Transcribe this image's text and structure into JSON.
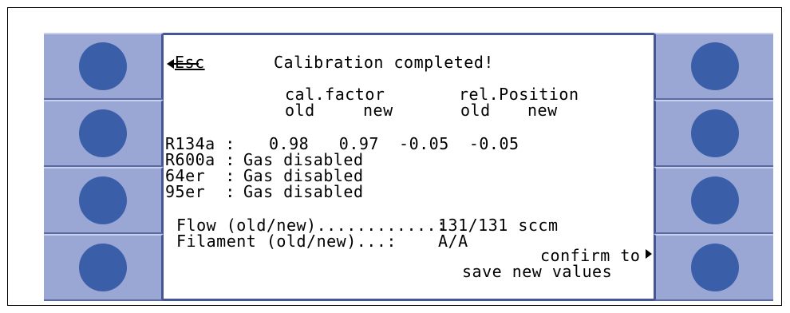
{
  "screen": {
    "esc_label": "Esc",
    "title": "Calibration completed!",
    "header_cal": "cal.factor",
    "header_rel": "rel.Position",
    "sub_old_1": "old",
    "sub_new_1": "new",
    "sub_old_2": "old",
    "sub_new_2": "new",
    "rows": [
      {
        "name": "R134a :",
        "value": "0.98   0.97  -0.05  -0.05"
      },
      {
        "name": "R600a :",
        "value": "Gas disabled"
      },
      {
        "name": "64er  :",
        "value": "Gas disabled"
      },
      {
        "name": "95er  :",
        "value": "Gas disabled"
      }
    ],
    "flow_label": "Flow (old/new)............:",
    "flow_value": "131/131 sccm",
    "filament_label": "Filament (old/new)...:",
    "filament_value": "A/A",
    "confirm_line1": "confirm to",
    "confirm_line2": "save new values"
  },
  "colors": {
    "key_background": "#9aa6d4",
    "key_button": "#3a5fa8",
    "frame_border": "#44559a"
  },
  "icons": {
    "esc_arrow": "arrow-left-icon",
    "confirm_arrow": "arrow-right-icon"
  }
}
